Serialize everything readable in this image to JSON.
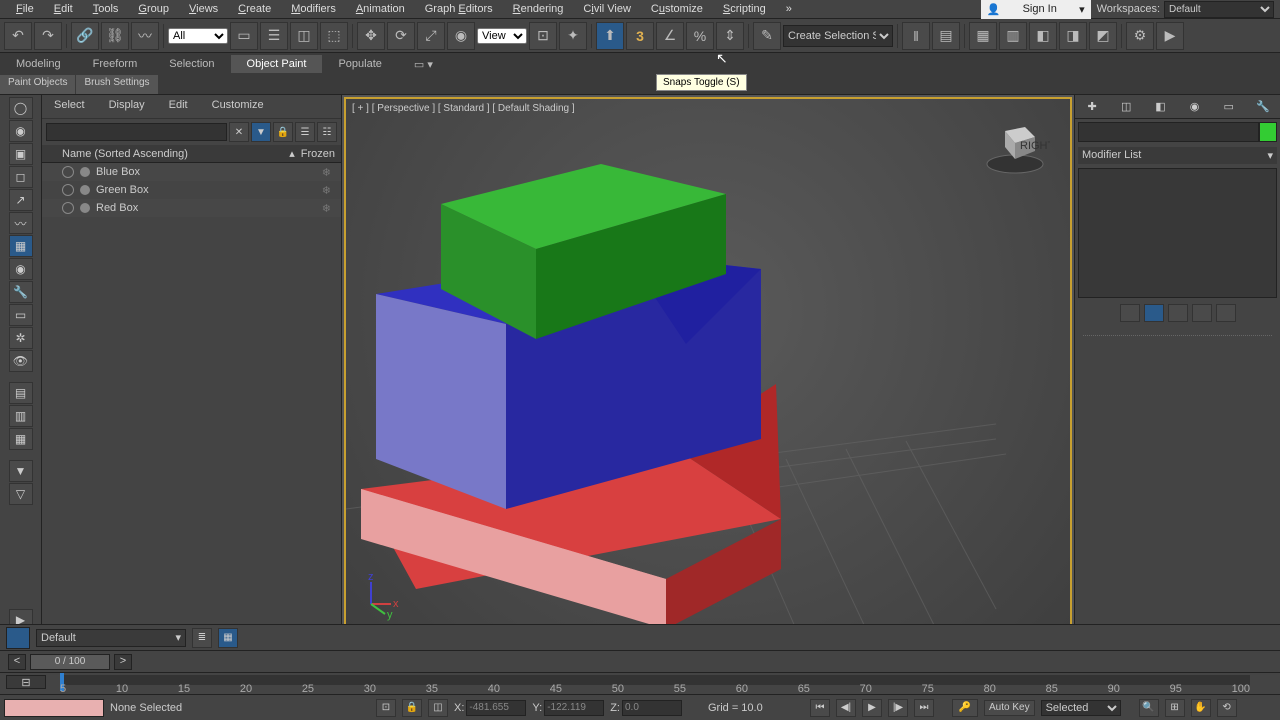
{
  "menu": {
    "items": [
      "File",
      "Edit",
      "Tools",
      "Group",
      "Views",
      "Create",
      "Modifiers",
      "Animation",
      "Graph Editors",
      "Rendering",
      "Civil View",
      "Customize",
      "Scripting"
    ]
  },
  "signin": {
    "label": "Sign In",
    "arrow": "▾"
  },
  "workspace": {
    "label": "Workspaces:",
    "value": "Default"
  },
  "toolbar": {
    "filter": "All",
    "refsys": "View",
    "selset": "Create Selection Se"
  },
  "ribbon": {
    "tabs": [
      "Modeling",
      "Freeform",
      "Selection",
      "Object Paint",
      "Populate"
    ],
    "selected": "Object Paint",
    "sub": [
      "Paint Objects",
      "Brush Settings"
    ]
  },
  "scene": {
    "tabs": [
      "Select",
      "Display",
      "Edit",
      "Customize"
    ],
    "search_placeholder": "",
    "head_name": "Name (Sorted Ascending)",
    "head_frozen": "Frozen",
    "items": [
      {
        "name": "Blue Box"
      },
      {
        "name": "Green Box"
      },
      {
        "name": "Red Box"
      }
    ]
  },
  "viewport": {
    "label": "[ + ] [ Perspective ] [ Standard ] [ Default Shading ]"
  },
  "tooltip": {
    "text": "Snaps Toggle   (S)"
  },
  "modpanel": {
    "modlist": "Modifier List"
  },
  "timeline": {
    "pos": "0 / 100",
    "ticks": [
      "5",
      "10",
      "15",
      "20",
      "25",
      "30",
      "35",
      "40",
      "45",
      "50",
      "55",
      "60",
      "65",
      "70",
      "75",
      "80",
      "85",
      "90",
      "95",
      "100"
    ]
  },
  "status": {
    "sel": "None Selected",
    "x_label": "X:",
    "x": "-481.655",
    "y_label": "Y:",
    "y": "-122.119",
    "z_label": "Z:",
    "z": "0.0",
    "grid": "Grid = 10.0",
    "autokey": "Auto Key",
    "keymode": "Selected"
  },
  "matrow": {
    "default": "Default"
  }
}
